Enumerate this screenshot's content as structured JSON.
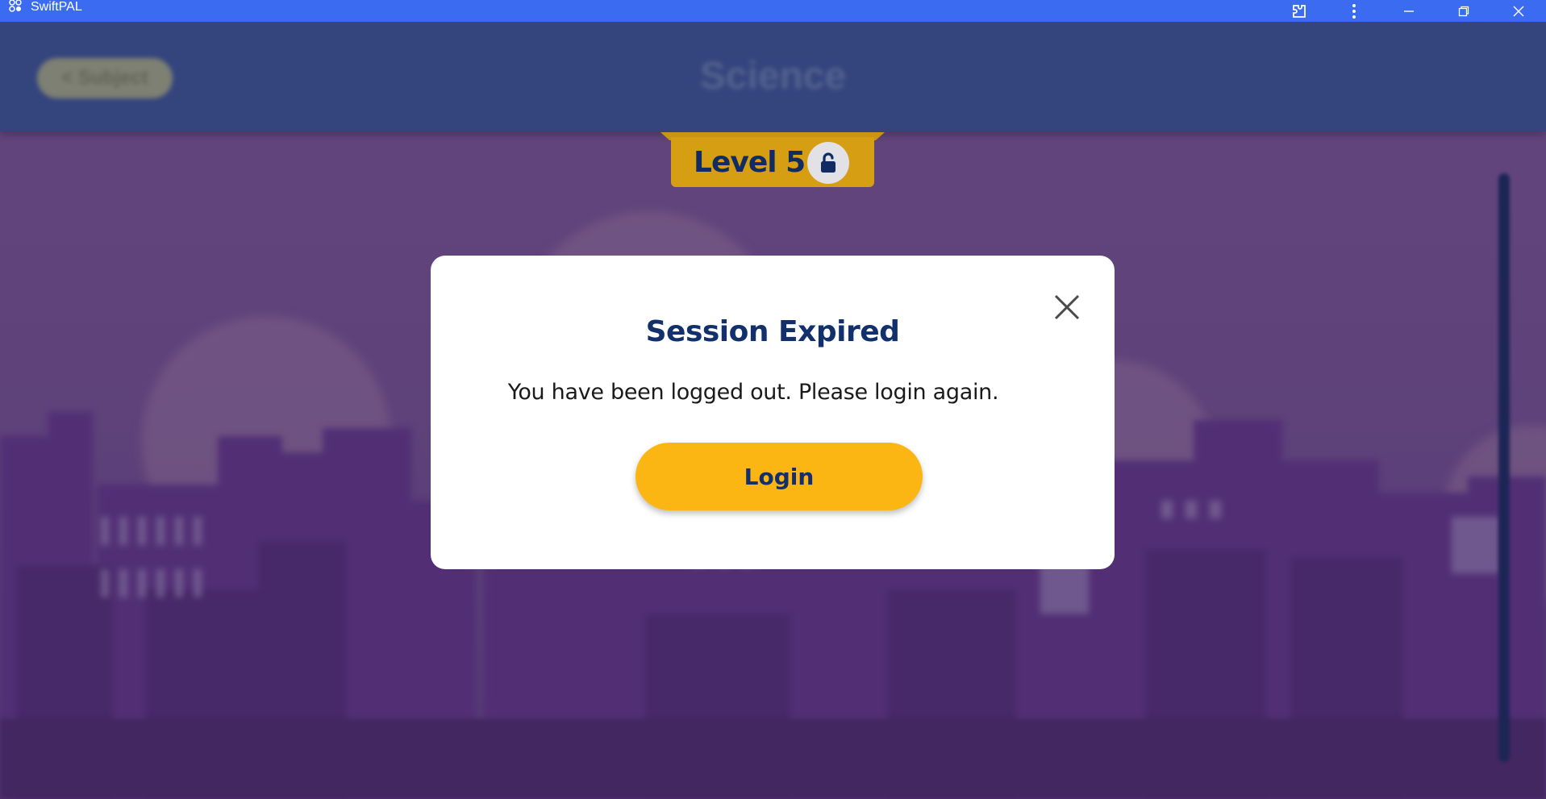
{
  "window": {
    "title": "SwiftPAL",
    "controls": [
      "extensions-icon",
      "more-icon",
      "minimize-icon",
      "restore-icon",
      "close-icon"
    ]
  },
  "app_header": {
    "back_label": "< Subject",
    "title": "Science"
  },
  "level_banner": {
    "label": "Level 5",
    "icon": "unlock-icon"
  },
  "dialog": {
    "title": "Session Expired",
    "message": "You have been logged out. Please login again.",
    "login_label": "Login",
    "close_icon": "close-icon"
  },
  "colors": {
    "titlebar": "#3a6bf0",
    "navy": "#12306b",
    "accent_yellow": "#fbb614",
    "banner_yellow": "#f2b410",
    "background_purple": "#6b4b8a"
  }
}
